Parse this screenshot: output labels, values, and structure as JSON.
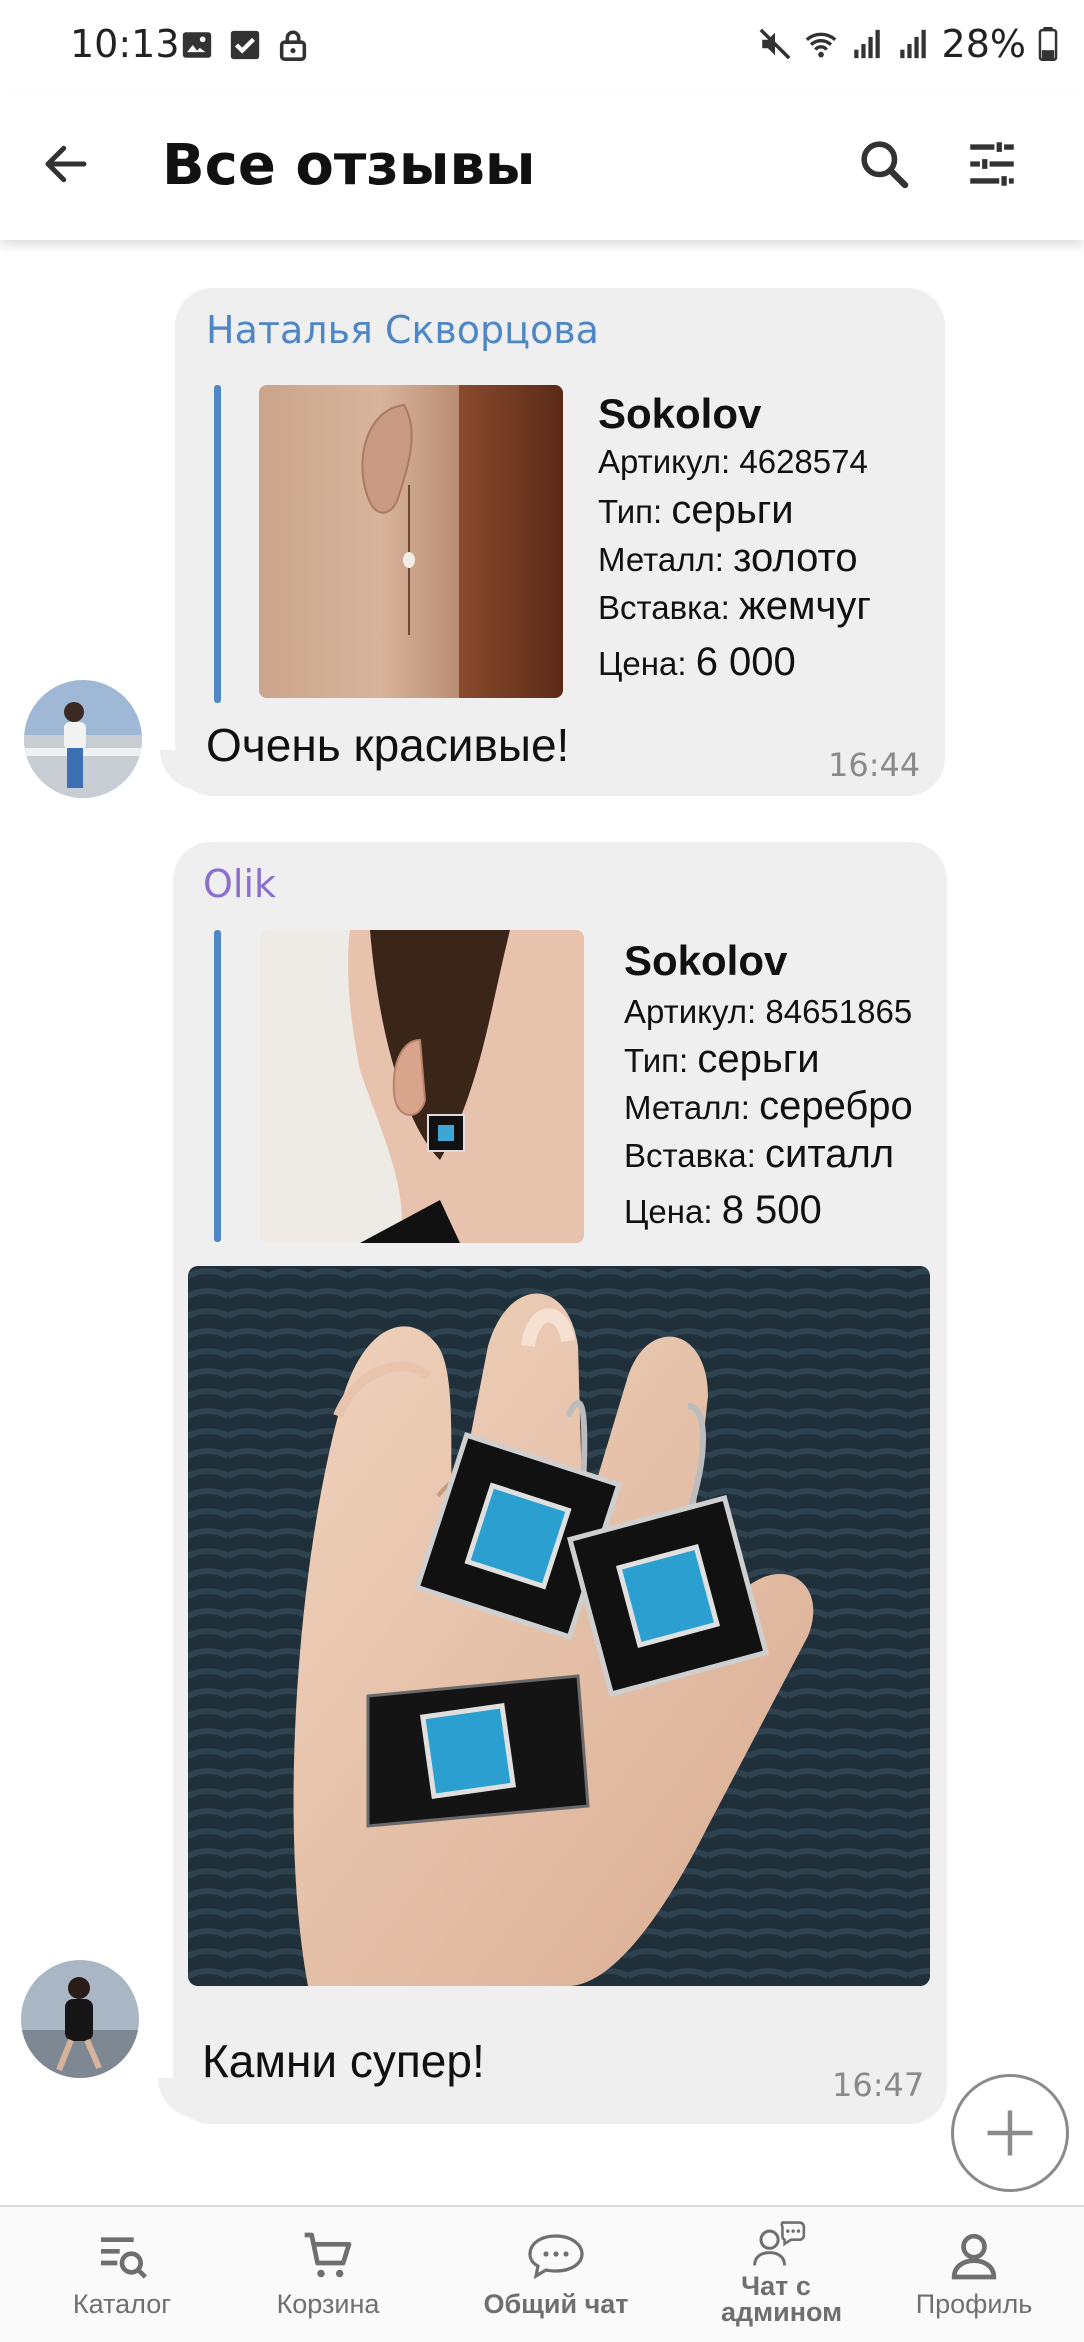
{
  "status_bar": {
    "time": "10:13",
    "battery": "28%",
    "left_icons": [
      "gallery-icon",
      "checkbox-icon",
      "lock-icon"
    ],
    "right_icons": [
      "mute-icon",
      "wifi-icon",
      "signal-icon",
      "signal-icon",
      "battery-icon"
    ]
  },
  "header": {
    "title": "Все отзывы",
    "back_icon": "arrow-left-icon",
    "search_icon": "search-icon",
    "filter_icon": "sliders-icon"
  },
  "reviews": [
    {
      "author": "Наталья Скворцова",
      "author_color": "#4f86c6",
      "product": {
        "brand": "Sokolov",
        "article_label": "Артикул:",
        "article": "4628574",
        "type_label": "Тип:",
        "type": "серьги",
        "metal_label": "Металл:",
        "metal": "золото",
        "insert_label": "Вставка:",
        "insert": "жемчуг",
        "price_label": "Цена:",
        "price": "6 000"
      },
      "text": "Очень красивые!",
      "time": "16:44"
    },
    {
      "author": "Olik",
      "author_color": "#8a6fcf",
      "product": {
        "brand": "Sokolov",
        "article_label": "Артикул:",
        "article": "84651865",
        "type_label": "Тип:",
        "type": "серьги",
        "metal_label": "Металл:",
        "metal": "серебро",
        "insert_label": "Вставка:",
        "insert": "ситалл",
        "price_label": "Цена:",
        "price": "8 500"
      },
      "text": "Камни супер!",
      "time": "16:47"
    }
  ],
  "fab": {
    "icon": "plus-icon"
  },
  "bottom_nav": [
    {
      "label": "Каталог",
      "icon": "catalog-search-icon"
    },
    {
      "label": "Корзина",
      "icon": "cart-icon"
    },
    {
      "label": "Общий чат",
      "icon": "chat-bubble-icon"
    },
    {
      "label": "Чат с админом",
      "icon": "admin-chat-icon"
    },
    {
      "label": "Профиль",
      "icon": "profile-icon"
    }
  ],
  "colors": {
    "accent_blue": "#4f86c6",
    "bubble_bg": "#efefef",
    "nav_text": "#6f6f6f"
  }
}
